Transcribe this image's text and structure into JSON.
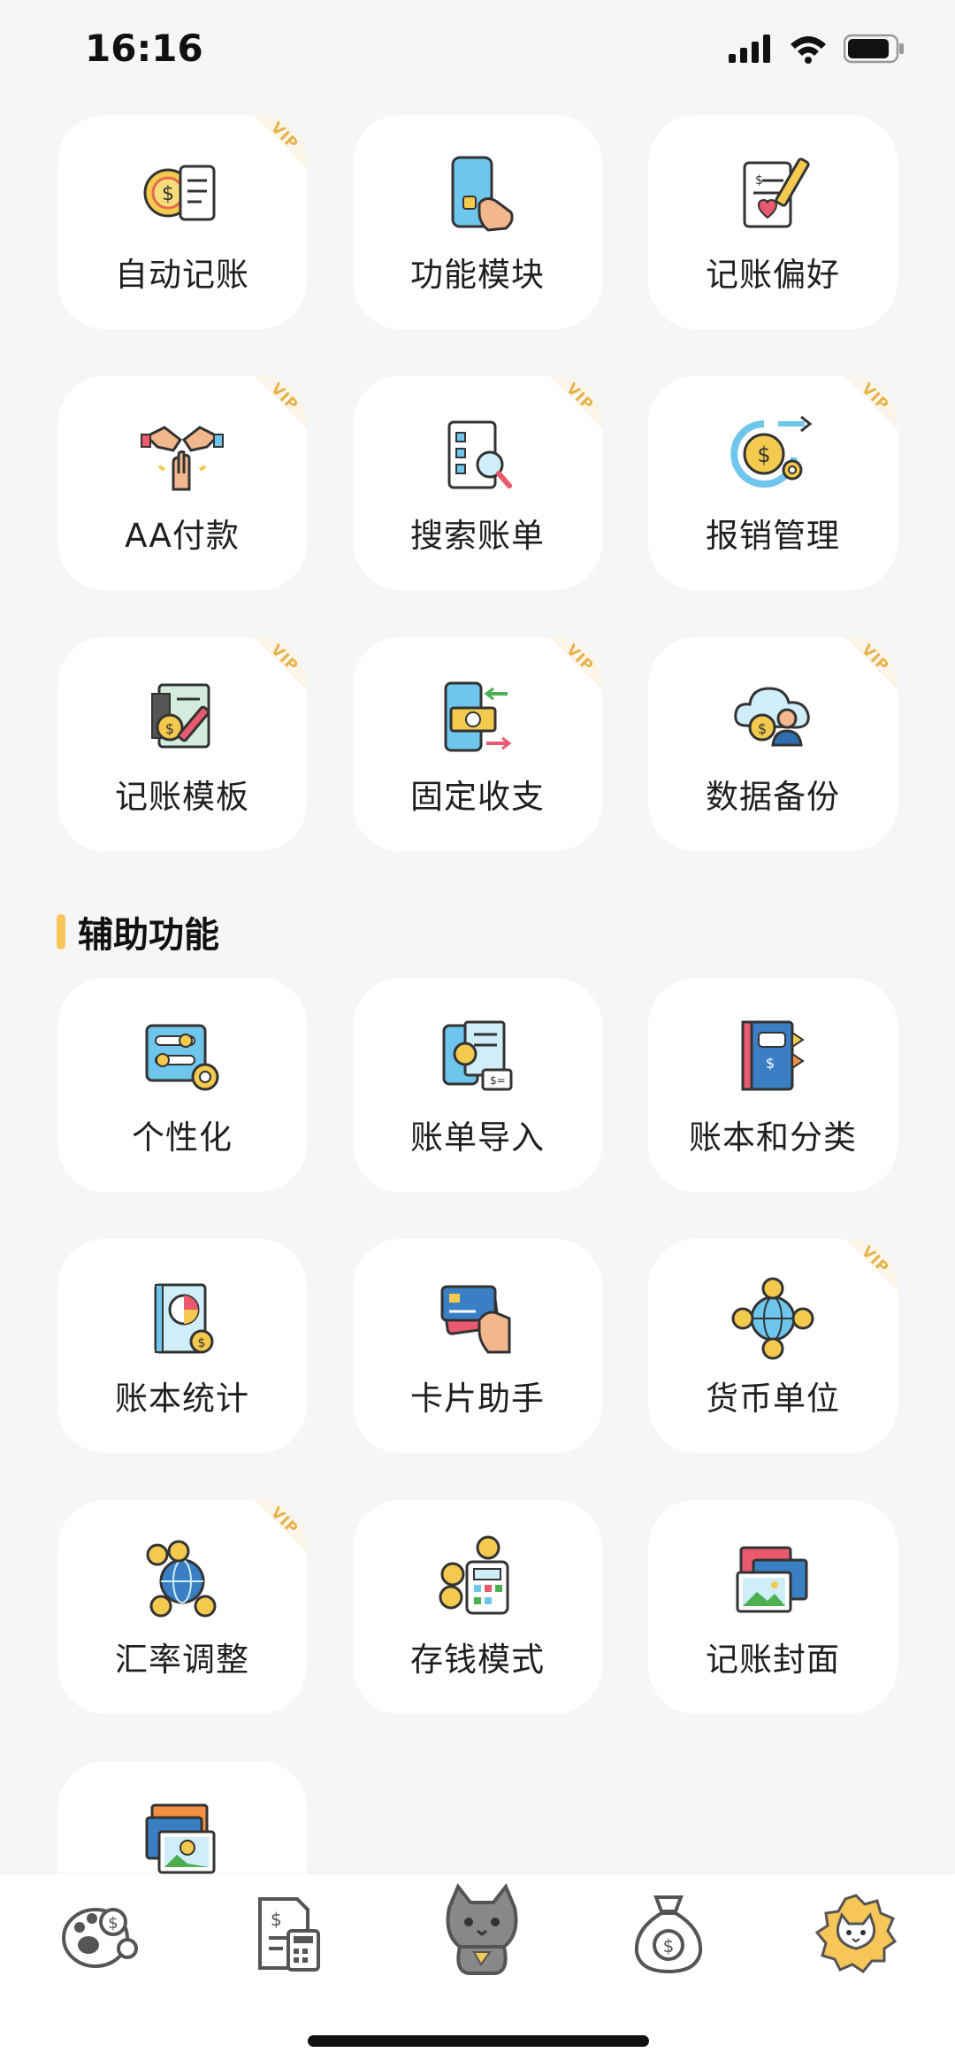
{
  "status_bar": {
    "time": "16:16"
  },
  "vip_badge": "VIP",
  "section": {
    "title": "辅助功能"
  },
  "top_features": [
    {
      "label": "自动记账",
      "icon": "auto-bookkeeping-icon",
      "vip": true
    },
    {
      "label": "功能模块",
      "icon": "function-module-icon",
      "vip": false
    },
    {
      "label": "记账偏好",
      "icon": "bookkeeping-preference-icon",
      "vip": false
    },
    {
      "label": "AA付款",
      "icon": "split-payment-icon",
      "vip": true
    },
    {
      "label": "搜索账单",
      "icon": "search-bill-icon",
      "vip": true
    },
    {
      "label": "报销管理",
      "icon": "reimbursement-icon",
      "vip": true
    },
    {
      "label": "记账模板",
      "icon": "template-icon",
      "vip": true
    },
    {
      "label": "固定收支",
      "icon": "fixed-income-expense-icon",
      "vip": true
    },
    {
      "label": "数据备份",
      "icon": "data-backup-icon",
      "vip": true
    }
  ],
  "aux_features": [
    {
      "label": "个性化",
      "icon": "personalization-icon",
      "vip": false
    },
    {
      "label": "账单导入",
      "icon": "bill-import-icon",
      "vip": false
    },
    {
      "label": "账本和分类",
      "icon": "ledger-category-icon",
      "vip": false
    },
    {
      "label": "账本统计",
      "icon": "ledger-statistics-icon",
      "vip": false
    },
    {
      "label": "卡片助手",
      "icon": "card-assistant-icon",
      "vip": false
    },
    {
      "label": "货币单位",
      "icon": "currency-unit-icon",
      "vip": true
    },
    {
      "label": "汇率调整",
      "icon": "exchange-rate-icon",
      "vip": true
    },
    {
      "label": "存钱模式",
      "icon": "saving-mode-icon",
      "vip": false
    },
    {
      "label": "记账封面",
      "icon": "bookkeeping-cover-icon",
      "vip": false
    },
    {
      "label": "",
      "icon": "photo-gallery-icon",
      "vip": false
    }
  ],
  "bottom_nav": [
    {
      "icon": "paw-coin-icon"
    },
    {
      "icon": "bill-calculator-icon"
    },
    {
      "icon": "cat-mascot-icon"
    },
    {
      "icon": "money-bag-icon"
    },
    {
      "icon": "cat-settings-icon"
    }
  ],
  "colors": {
    "accent": "#f6c658",
    "vip": "#e8b24a",
    "card": "#ffffff",
    "background": "#f6f6f6"
  }
}
